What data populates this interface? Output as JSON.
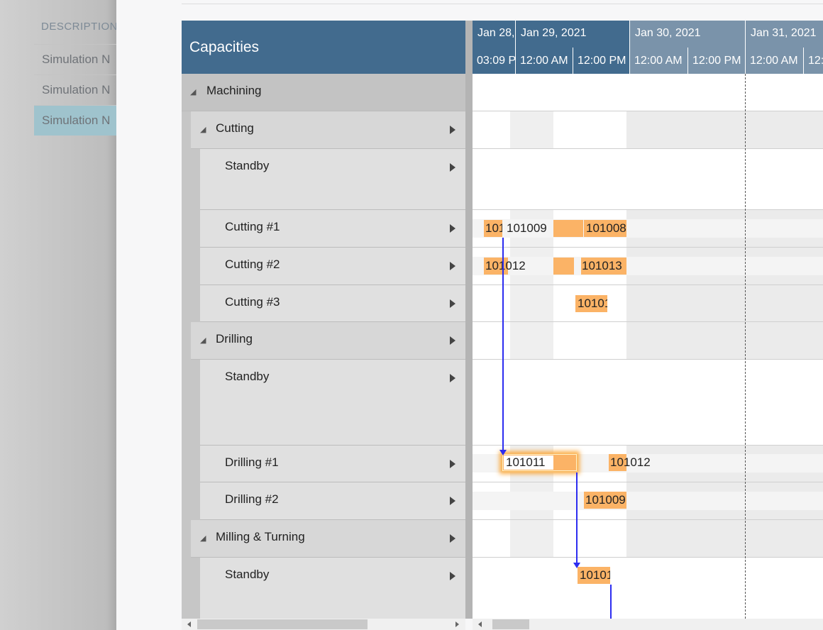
{
  "background_list": {
    "header": "DESCRIPTION",
    "rows": [
      "Simulation N",
      "Simulation N",
      "Simulation N"
    ]
  },
  "grid": {
    "title": "Capacities",
    "rows": [
      {
        "label": "Machining"
      },
      {
        "label": "Cutting"
      },
      {
        "label": "Standby"
      },
      {
        "label": "Cutting #1"
      },
      {
        "label": "Cutting #2"
      },
      {
        "label": "Cutting #3"
      },
      {
        "label": "Drilling"
      },
      {
        "label": "Standby"
      },
      {
        "label": "Drilling #1"
      },
      {
        "label": "Drilling #2"
      },
      {
        "label": "Milling & Turning"
      },
      {
        "label": "Standby"
      }
    ]
  },
  "timeline": {
    "dates": [
      "Jan 28,",
      "Jan 29, 2021",
      "Jan 30, 2021",
      "Jan 31, 2021"
    ],
    "times": [
      "03:09 P",
      "12:00 AM",
      "12:00 PM",
      "12:00 AM",
      "12:00 PM",
      "12:00 AM",
      "12:"
    ],
    "tasks": {
      "t1": "101",
      "t2": "101009",
      "t3": "101008",
      "t4": "101012",
      "t5": "101013",
      "t6": "10101",
      "t7": "101011",
      "t8": "101012",
      "t9": "101009",
      "t10": "10101"
    }
  },
  "colors": {
    "header_dark": "#426b8e",
    "header_light": "#7a93aa",
    "task": "#fbb366",
    "dependency": "#2d2df0"
  },
  "icons": [
    "expand-triangle-icon",
    "row-arrow-icon",
    "scroll-left-icon",
    "scroll-right-icon"
  ]
}
